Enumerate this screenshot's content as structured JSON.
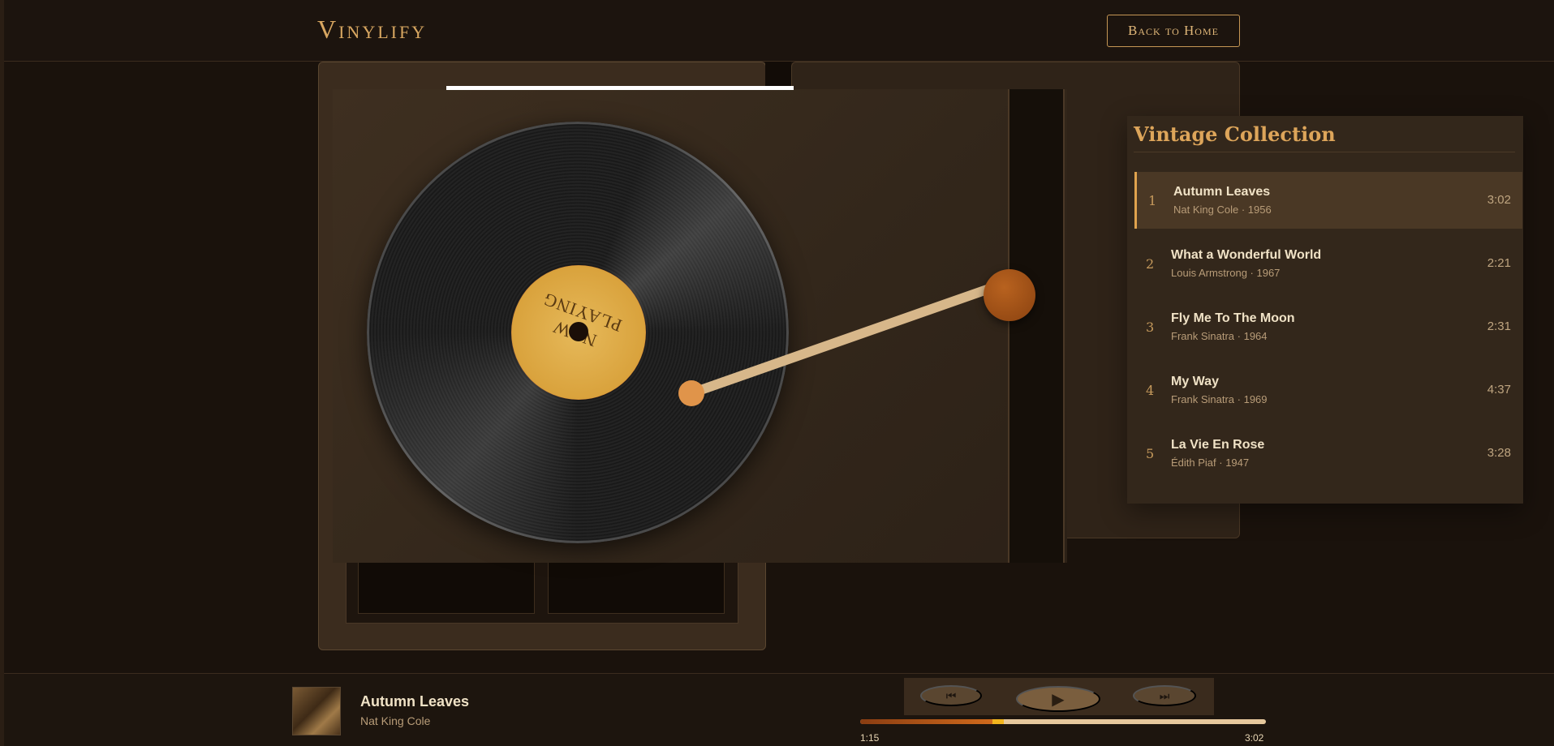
{
  "header": {
    "brand": "Vinylify",
    "back_label": "Back to Home"
  },
  "record": {
    "label_text": "NOW PLAYING"
  },
  "playlist": {
    "title": "Vintage Collection",
    "tracks": [
      {
        "num": "1",
        "title": "Autumn Leaves",
        "sub": "Nat King Cole · 1956",
        "duration": "3:02",
        "active": true
      },
      {
        "num": "2",
        "title": "What a Wonderful World",
        "sub": "Louis Armstrong · 1967",
        "duration": "2:21",
        "active": false
      },
      {
        "num": "3",
        "title": "Fly Me To The Moon",
        "sub": "Frank Sinatra · 1964",
        "duration": "2:31",
        "active": false
      },
      {
        "num": "4",
        "title": "My Way",
        "sub": "Frank Sinatra · 1969",
        "duration": "4:37",
        "active": false
      },
      {
        "num": "5",
        "title": "La Vie En Rose",
        "sub": "Édith Piaf · 1947",
        "duration": "3:28",
        "active": false
      }
    ]
  },
  "player": {
    "title": "Autumn Leaves",
    "artist": "Nat King Cole",
    "current_time": "1:15",
    "total_time": "3:02",
    "progress": 0.33,
    "prev_icon": "prev-icon",
    "play_icon": "play-icon",
    "next_icon": "next-icon"
  },
  "colors": {
    "accent": "#dda55a",
    "background": "#1a120c"
  }
}
